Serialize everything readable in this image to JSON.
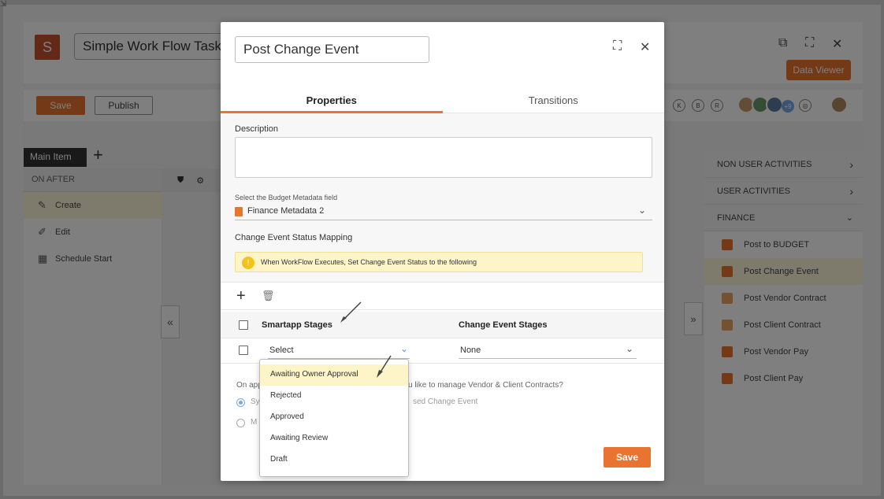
{
  "background_app": {
    "logo_letter": "S",
    "title": "Simple Work Flow Task",
    "data_viewer_label": "Data Viewer",
    "save_label": "Save",
    "publish_label": "Publish",
    "main_item_tab": "Main Item",
    "on_after_label": "ON AFTER",
    "left_items": [
      {
        "label": "Create",
        "icon": "create-icon",
        "active": true
      },
      {
        "label": "Edit",
        "icon": "edit-icon",
        "active": false
      },
      {
        "label": "Schedule Start",
        "icon": "schedule-icon",
        "active": false
      }
    ],
    "avatar_more": "+9",
    "right_sections": [
      {
        "label": "NON USER ACTIVITIES",
        "chevron": ">"
      },
      {
        "label": "USER ACTIVITIES",
        "chevron": ">"
      },
      {
        "label": "FINANCE",
        "chevron": "v"
      }
    ],
    "finance_items": [
      {
        "label": "Post to BUDGET",
        "color": "#e8742f",
        "active": false
      },
      {
        "label": "Post Change Event",
        "color": "#e8742f",
        "active": true
      },
      {
        "label": "Post Vendor Contract",
        "color": "#e8a45f",
        "active": false
      },
      {
        "label": "Post Client Contract",
        "color": "#e8a45f",
        "active": false
      },
      {
        "label": "Post Vendor Pay",
        "color": "#e8742f",
        "active": false
      },
      {
        "label": "Post Client Pay",
        "color": "#e8742f",
        "active": false
      }
    ]
  },
  "modal": {
    "title": "Post Change Event",
    "tabs": [
      {
        "label": "Properties",
        "active": true
      },
      {
        "label": "Transitions",
        "active": false
      }
    ],
    "description_label": "Description",
    "budget_field_label": "Select the Budget Metadata field",
    "budget_field_value": "Finance Metadata 2",
    "status_mapping_label": "Change Event Status Mapping",
    "info_text": "When WorkFlow Executes, Set Change Event Status to the following",
    "table": {
      "headers": [
        "Smartapp Stages",
        "Change Event Stages"
      ],
      "row": {
        "smartapp_stage": "Select",
        "change_event_stage": "None"
      }
    },
    "question_prefix": "On app",
    "question_suffix": "u like to manage Vendor & Client Contracts?",
    "radio1_prefix": "Sy",
    "radio1_suffix": "sed Change Event",
    "radio2_prefix": "M",
    "save_label": "Save",
    "dropdown_options": [
      {
        "label": "Awaiting Owner Approval",
        "highlighted": true
      },
      {
        "label": "Rejected",
        "highlighted": false
      },
      {
        "label": "Approved",
        "highlighted": false
      },
      {
        "label": "Awaiting Review",
        "highlighted": false
      },
      {
        "label": "Draft",
        "highlighted": false
      }
    ]
  },
  "colors": {
    "accent": "#e8742f",
    "highlight": "#fdf5c8"
  }
}
